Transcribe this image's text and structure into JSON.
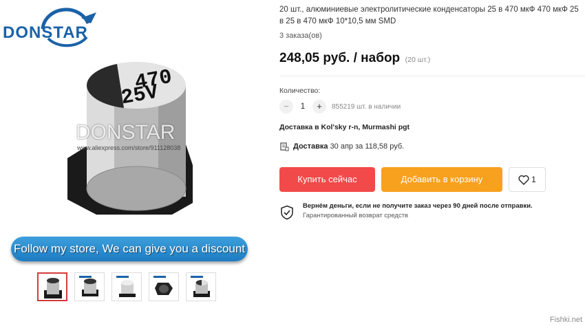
{
  "gallery": {
    "brand_logo_text": "DONSTAR",
    "watermark_brand": "DONSTAR",
    "watermark_url": "www.aliexpress.com/store/911128038",
    "capacitor_marking_line1": "470",
    "capacitor_marking_line2": "25V",
    "promo_banner": "Follow my store,   We can give you a discount",
    "thumbnails": [
      {
        "label": "thumbnail-1",
        "active": true
      },
      {
        "label": "thumbnail-2",
        "active": false
      },
      {
        "label": "thumbnail-3",
        "active": false
      },
      {
        "label": "thumbnail-4",
        "active": false
      },
      {
        "label": "thumbnail-5",
        "active": false
      }
    ]
  },
  "product": {
    "title": "20 шт., алюминиевые электролитические конденсаторы 25 в 470 мкФ 470 мкФ 25 в 25 в 470 мкФ 10*10,5 мм SMD",
    "orders": "3 заказа(ов)",
    "price": "248,05 руб. / набор",
    "price_unit": "(20 шт.)"
  },
  "quantity": {
    "label": "Количество:",
    "value": "1",
    "minus": "−",
    "plus": "+",
    "stock": "855219 шт. в наличии"
  },
  "delivery": {
    "destination": "Доставка в Kol'sky r-n, Murmashi pgt",
    "label": "Доставка",
    "details": "30 апр за 118,58 руб."
  },
  "actions": {
    "buy_now": "Купить сейчас",
    "add_to_cart": "Добавить в корзину",
    "wishlist_count": "1"
  },
  "guarantee": {
    "title": "Вернём деньги, если не получите заказ через 90 дней после отправки.",
    "subtitle": "Гарантированный возврат средств"
  },
  "site_watermark": "Fishki.net",
  "colors": {
    "buy": "#f24a4a",
    "cart": "#f7a11f",
    "brand": "#1b62a8",
    "banner": "#2a8ccf"
  }
}
